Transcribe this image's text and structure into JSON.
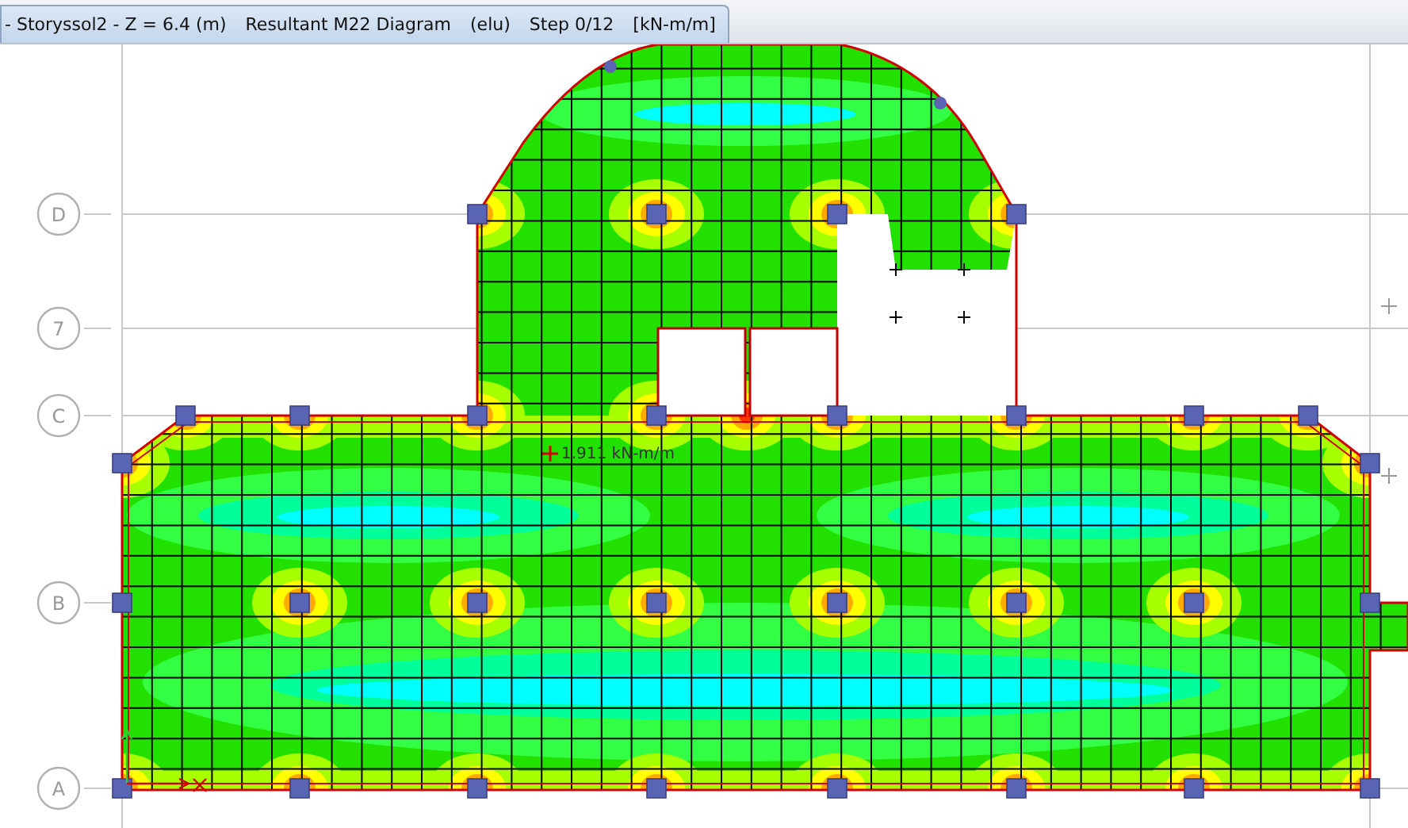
{
  "view_tab": {
    "story": "- Storyssol2 - Z = 6.4 (m)",
    "diagram": "Resultant M22 Diagram",
    "load_case": "(elu)",
    "step": "Step 0/12",
    "units": "[kN-m/m]"
  },
  "grid_lines": [
    {
      "label": "D"
    },
    {
      "label": "7"
    },
    {
      "label": "C"
    },
    {
      "label": "B"
    },
    {
      "label": "A"
    }
  ],
  "annotation": {
    "value": "1.911 kN-m/m"
  }
}
